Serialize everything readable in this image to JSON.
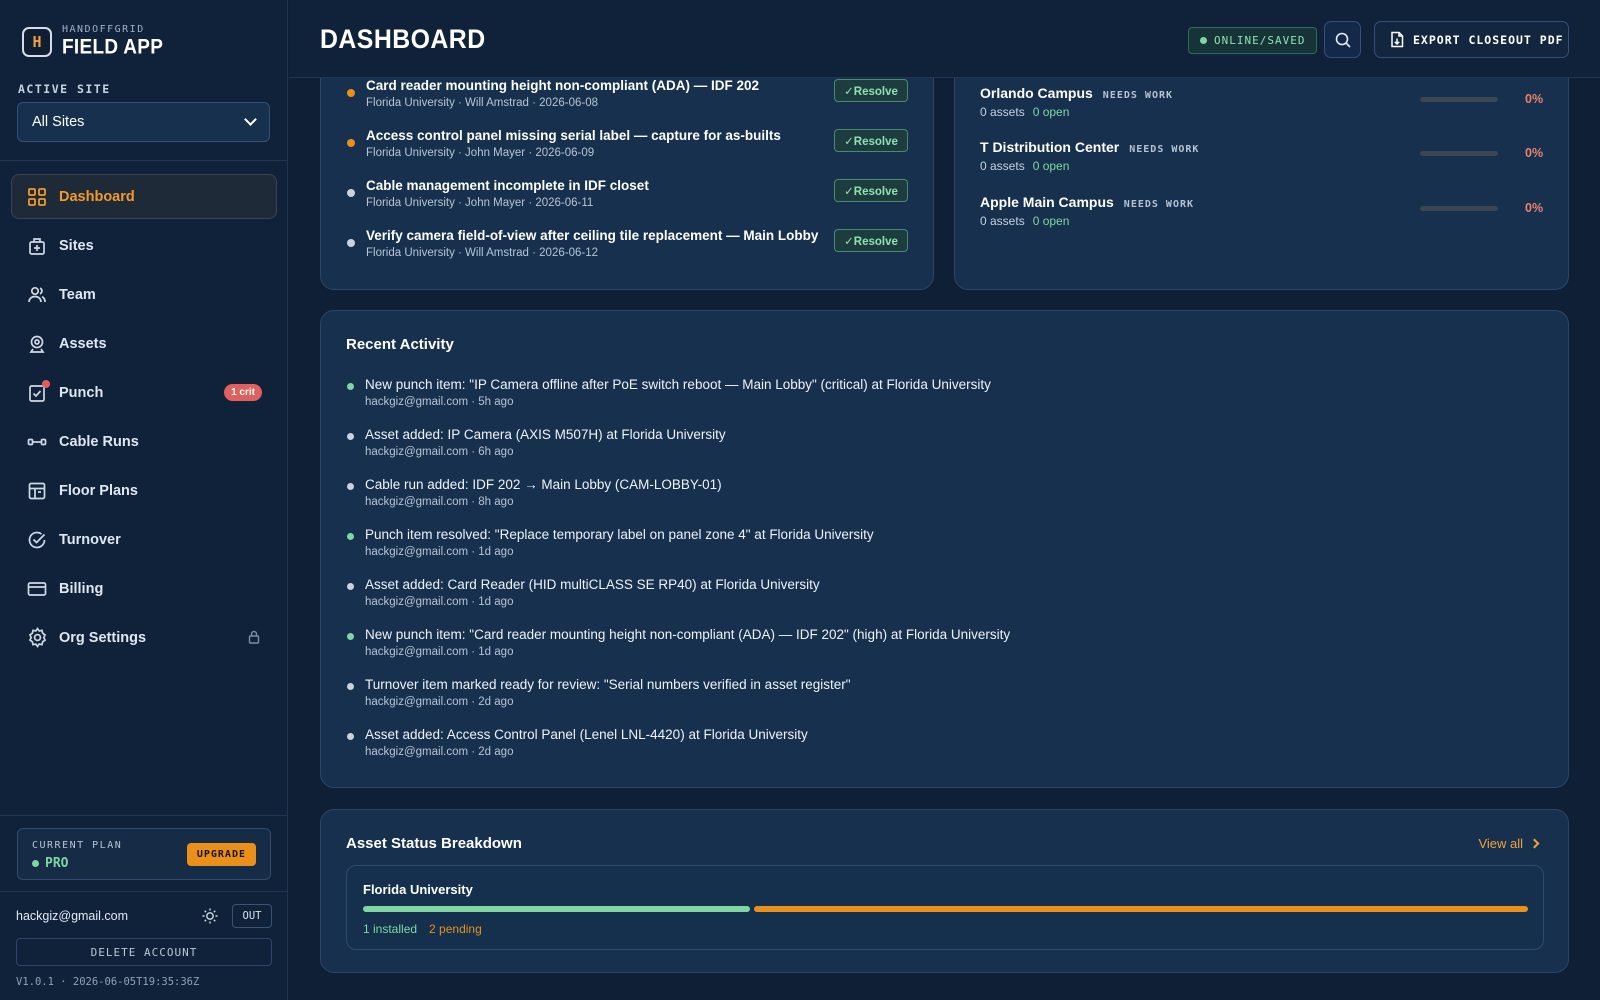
{
  "brand": {
    "small": "HANDOFFGRID",
    "big": "FIELD APP",
    "logo_letter": "H"
  },
  "sidebar": {
    "site_label": "ACTIVE SITE",
    "site_select_value": "All Sites",
    "items": [
      {
        "label": "Dashboard",
        "icon": "grid-icon",
        "active": true
      },
      {
        "label": "Sites",
        "icon": "building-icon"
      },
      {
        "label": "Team",
        "icon": "users-icon"
      },
      {
        "label": "Assets",
        "icon": "camera-icon"
      },
      {
        "label": "Punch",
        "icon": "checklist-icon",
        "badge": "1 crit"
      },
      {
        "label": "Cable Runs",
        "icon": "cable-icon"
      },
      {
        "label": "Floor Plans",
        "icon": "floorplan-icon"
      },
      {
        "label": "Turnover",
        "icon": "check-circle-icon"
      },
      {
        "label": "Billing",
        "icon": "credit-card-icon"
      },
      {
        "label": "Org Settings",
        "icon": "gear-icon",
        "locked": true
      }
    ],
    "plan": {
      "label": "CURRENT PLAN",
      "value": "PRO",
      "upgrade": "UPGRADE"
    },
    "user_email": "hackgiz@gmail.com",
    "out_label": "OUT",
    "delete_label": "DELETE ACCOUNT",
    "version": "V1.0.1 · 2026-06-05T19:35:36Z"
  },
  "header": {
    "title": "DASHBOARD",
    "status": "ONLINE/SAVED",
    "export_label": "EXPORT CLOSEOUT PDF"
  },
  "punch_items": [
    {
      "title": "Card reader mounting height non-compliant (ADA) — IDF 202",
      "meta": "Florida University · Will Amstrad · 2026-06-08",
      "priority_color": "#e8901a",
      "action": "✓Resolve"
    },
    {
      "title": "Access control panel missing serial label — capture for as-builts",
      "meta": "Florida University · John Mayer · 2026-06-09",
      "priority_color": "#e8901a",
      "action": "✓Resolve"
    },
    {
      "title": "Cable management incomplete in IDF closet",
      "meta": "Florida University · John Mayer · 2026-06-11",
      "priority_color": "#c9d3df",
      "action": "✓Resolve"
    },
    {
      "title": "Verify camera field-of-view after ceiling tile replacement — Main Lobby",
      "meta": "Florida University · Will Amstrad · 2026-06-12",
      "priority_color": "#c9d3df",
      "action": "✓Resolve"
    }
  ],
  "sites": [
    {
      "name": "Orlando Campus",
      "tag": "NEEDS WORK",
      "assets": "0 assets",
      "open": "0 open",
      "pct": "0%",
      "progress": 0
    },
    {
      "name": "T Distribution Center",
      "tag": "NEEDS WORK",
      "assets": "0 assets",
      "open": "0 open",
      "pct": "0%",
      "progress": 0
    },
    {
      "name": "Apple Main Campus",
      "tag": "NEEDS WORK",
      "assets": "0 assets",
      "open": "0 open",
      "pct": "0%",
      "progress": 0
    }
  ],
  "activity": {
    "title": "Recent Activity",
    "items": [
      {
        "text": "New punch item: \"IP Camera offline after PoE switch reboot — Main Lobby\" (critical) at Florida University",
        "meta": "hackgiz@gmail.com · 5h ago",
        "dot": "#7fd6a2"
      },
      {
        "text": "Asset added: IP Camera (AXIS M507H) at Florida University",
        "meta": "hackgiz@gmail.com · 6h ago",
        "dot": "#c9d3df"
      },
      {
        "text": "Cable run added: IDF 202 → Main Lobby (CAM-LOBBY-01)",
        "meta": "hackgiz@gmail.com · 8h ago",
        "dot": "#c9d3df"
      },
      {
        "text": "Punch item resolved: \"Replace temporary label on panel zone 4\" at Florida University",
        "meta": "hackgiz@gmail.com · 1d ago",
        "dot": "#7fd6a2"
      },
      {
        "text": "Asset added: Card Reader (HID multiCLASS SE RP40) at Florida University",
        "meta": "hackgiz@gmail.com · 1d ago",
        "dot": "#c9d3df"
      },
      {
        "text": "New punch item: \"Card reader mounting height non-compliant (ADA) — IDF 202\" (high) at Florida University",
        "meta": "hackgiz@gmail.com · 1d ago",
        "dot": "#7fd6a2"
      },
      {
        "text": "Turnover item marked ready for review: \"Serial numbers verified in asset register\"",
        "meta": "hackgiz@gmail.com · 2d ago",
        "dot": "#c9d3df"
      },
      {
        "text": "Asset added: Access Control Panel (Lenel LNL-4420) at Florida University",
        "meta": "hackgiz@gmail.com · 2d ago",
        "dot": "#c9d3df"
      }
    ]
  },
  "asset_status": {
    "title": "Asset Status Breakdown",
    "view_all": "View all",
    "site": "Florida University",
    "installed": 1,
    "pending": 2,
    "installed_label": "1 installed",
    "pending_label": "2 pending",
    "installed_color": "#7fd6a2",
    "pending_color": "#e8901a"
  }
}
